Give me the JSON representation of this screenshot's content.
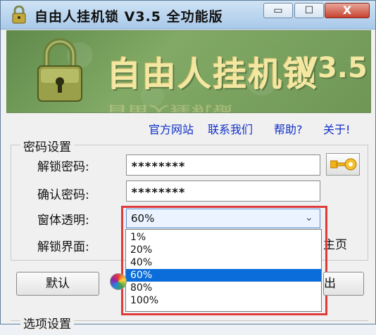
{
  "window": {
    "title": "自由人挂机锁 V3.5 全功能版",
    "controls": {
      "minimize": "▭",
      "maximize": "☐",
      "close": "X"
    }
  },
  "banner": {
    "title": "自由人挂机锁",
    "version": "V3.5"
  },
  "links": {
    "official_site": "官方网站",
    "contact_us": "联系我们",
    "help": "帮助?",
    "about": "关于!"
  },
  "password_section": {
    "legend": "密码设置",
    "unlock_password_label": "解锁密码:",
    "unlock_password_value": "********",
    "confirm_password_label": "确认密码:",
    "confirm_password_value": "********",
    "transparency_label": "窗体透明:",
    "transparency_value": "60%",
    "transparency_options": [
      "1%",
      "20%",
      "40%",
      "60%",
      "80%",
      "100%"
    ],
    "unlock_ui_label": "解锁界面:",
    "right_fragment": "主页"
  },
  "buttons": {
    "default_label": "默认",
    "exit_fragment": "出"
  },
  "options_section": {
    "legend": "选项设置"
  },
  "colors": {
    "highlight": "#e03b3b",
    "selected_option": "#0a6dd9",
    "link": "#1030c8"
  }
}
